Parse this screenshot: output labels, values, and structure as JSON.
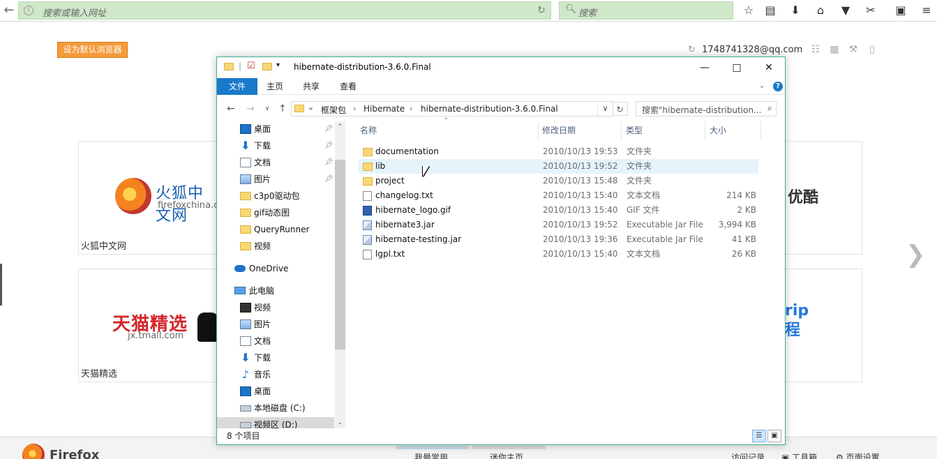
{
  "browser": {
    "url_placeholder": "搜索或输入网址",
    "search_placeholder": "搜索"
  },
  "page": {
    "default_browser_button": "设为默认浏览器",
    "account": "1748741328@qq.com",
    "tiles": [
      {
        "logo_text": "火狐中文网",
        "logo_sub": "firefoxchina.cn",
        "caption": "火狐中文网"
      },
      {
        "logo_text": "天猫精选",
        "logo_sub": "jx.tmall.com",
        "caption": "天猫精选"
      },
      {
        "logo_text": "优酷"
      },
      {
        "logo_text": "rip 程"
      }
    ]
  },
  "bottom_bar": {
    "brand": "Firefox",
    "links": [
      "我最常用",
      "迷你主页",
      "访问记录",
      "工具箱",
      "页面设置"
    ]
  },
  "explorer": {
    "title": "hibernate-distribution-3.6.0.Final",
    "ribbon_tabs": [
      "文件",
      "主页",
      "共享",
      "查看"
    ],
    "address": {
      "overflow": "«",
      "segments": [
        "框架包",
        "Hibernate",
        "hibernate-distribution-3.6.0.Final"
      ]
    },
    "search_placeholder": "搜索\"hibernate-distribution...",
    "nav_items": [
      {
        "label": "桌面",
        "icon": "desktop-icon"
      },
      {
        "label": "下载",
        "icon": "download-icon"
      },
      {
        "label": "文档",
        "icon": "document-icon"
      },
      {
        "label": "图片",
        "icon": "pictures-icon"
      },
      {
        "label": "c3p0驱动包",
        "icon": "folder-icon"
      },
      {
        "label": "gif动态图",
        "icon": "folder-icon"
      },
      {
        "label": "QueryRunner",
        "icon": "folder-icon"
      },
      {
        "label": "视频",
        "icon": "folder-icon"
      },
      {
        "label": "OneDrive",
        "icon": "onedrive-icon"
      },
      {
        "label": "此电脑",
        "icon": "computer-icon"
      },
      {
        "label": "视频",
        "icon": "videos-icon"
      },
      {
        "label": "图片",
        "icon": "pictures-icon"
      },
      {
        "label": "文档",
        "icon": "document-icon"
      },
      {
        "label": "下载",
        "icon": "download-icon"
      },
      {
        "label": "音乐",
        "icon": "music-icon"
      },
      {
        "label": "桌面",
        "icon": "desktop-icon"
      },
      {
        "label": "本地磁盘 (C:)",
        "icon": "drive-icon"
      },
      {
        "label": "视频区 (D:)",
        "icon": "drive-icon"
      }
    ],
    "columns": [
      "名称",
      "修改日期",
      "类型",
      "大小"
    ],
    "files": [
      {
        "name": "documentation",
        "date": "2010/10/13 19:53",
        "type": "文件夹",
        "size": "",
        "icon": "fold"
      },
      {
        "name": "lib",
        "date": "2010/10/13 19:52",
        "type": "文件夹",
        "size": "",
        "icon": "fold"
      },
      {
        "name": "project",
        "date": "2010/10/13 15:48",
        "type": "文件夹",
        "size": "",
        "icon": "fold"
      },
      {
        "name": "changelog.txt",
        "date": "2010/10/13 15:40",
        "type": "文本文档",
        "size": "214 KB",
        "icon": "txt"
      },
      {
        "name": "hibernate_logo.gif",
        "date": "2010/10/13 15:40",
        "type": "GIF 文件",
        "size": "2 KB",
        "icon": "gif"
      },
      {
        "name": "hibernate3.jar",
        "date": "2010/10/13 19:52",
        "type": "Executable Jar File",
        "size": "3,994 KB",
        "icon": "jar"
      },
      {
        "name": "hibernate-testing.jar",
        "date": "2010/10/13 19:36",
        "type": "Executable Jar File",
        "size": "41 KB",
        "icon": "jar"
      },
      {
        "name": "lgpl.txt",
        "date": "2010/10/13 15:40",
        "type": "文本文档",
        "size": "26 KB",
        "icon": "txt"
      }
    ],
    "status": "8 个项目"
  }
}
